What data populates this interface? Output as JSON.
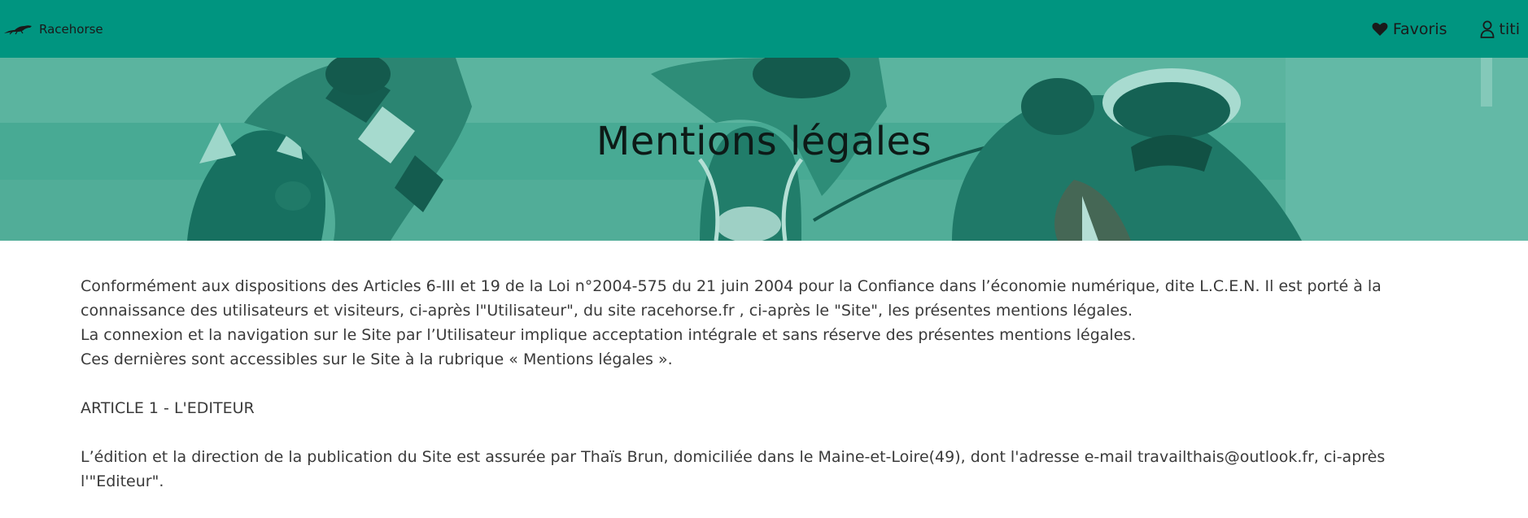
{
  "navbar": {
    "brand": "Racehorse",
    "favorites_label": "Favoris",
    "user_label": "titi",
    "colors": {
      "background": "#009580",
      "text": "#1a1a1a"
    },
    "icons": {
      "logo": "racehorse-logo-icon",
      "favorites": "heart-icon",
      "user": "user-icon"
    }
  },
  "hero": {
    "title": "Mentions légales",
    "image": "horse-racing-jockeys-photo"
  },
  "content": {
    "intro": [
      "Conformément aux dispositions des Articles 6-III et 19 de la Loi n°2004-575 du 21 juin 2004 pour la Confiance dans l’économie numérique, dite L.C.E.N. Il est porté à la",
      "connaissance des utilisateurs et visiteurs, ci-après l\"Utilisateur\", du site racehorse.fr , ci-après le \"Site\", les présentes mentions légales.",
      "La connexion et la navigation sur le Site par l’Utilisateur implique acceptation intégrale et sans réserve des présentes mentions légales.",
      "Ces dernières sont accessibles sur le Site à la rubrique « Mentions légales »."
    ],
    "article1_title": "ARTICLE 1 - L'EDITEUR",
    "article1_text": [
      "L’édition et la direction de la publication du Site est assurée par Thaïs Brun, domiciliée dans le Maine-et-Loire(49), dont l'adresse e-mail travailthais@outlook.fr, ci-après",
      "l'\"Editeur\"."
    ]
  }
}
